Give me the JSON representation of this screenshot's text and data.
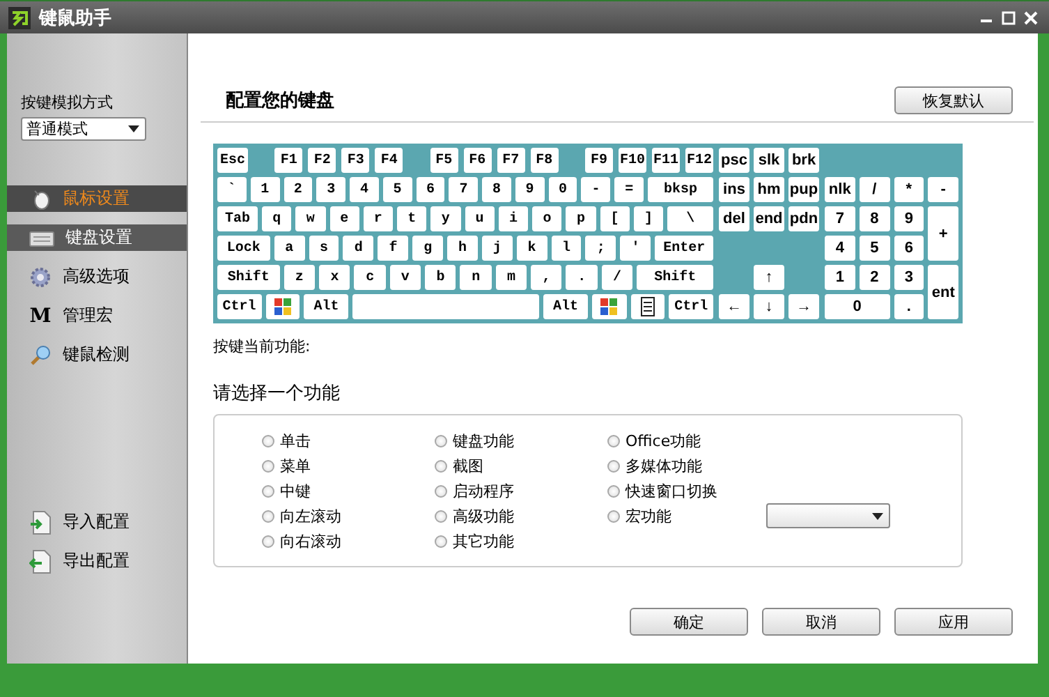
{
  "window": {
    "title": "键鼠助手"
  },
  "sidebar": {
    "mode_label": "按键模拟方式",
    "mode_value": "普通模式",
    "items": [
      {
        "kind": "mouse",
        "label": "鼠标设置",
        "selected": false,
        "hovered": true
      },
      {
        "kind": "keyboard",
        "label": "键盘设置",
        "selected": true,
        "hovered": false
      },
      {
        "kind": "gear",
        "label": "高级选项",
        "selected": false,
        "hovered": false
      },
      {
        "kind": "letter",
        "glyph": "M",
        "label": "管理宏",
        "selected": false,
        "hovered": false
      },
      {
        "kind": "magnifier",
        "label": "键鼠检测",
        "selected": false,
        "hovered": false
      }
    ],
    "bottom_items": [
      {
        "kind": "import",
        "label": "导入配置"
      },
      {
        "kind": "export",
        "label": "导出配置"
      }
    ]
  },
  "header": {
    "title": "配置您的键盘",
    "restore_button": "恢复默认"
  },
  "keyboard": {
    "main_rows": [
      [
        [
          {
            "kind": "key",
            "label": "Esc"
          }
        ],
        [
          {
            "kind": "key",
            "label": "F1"
          },
          {
            "kind": "key",
            "label": "F2"
          },
          {
            "kind": "key",
            "label": "F3"
          },
          {
            "kind": "key",
            "label": "F4"
          }
        ],
        [
          {
            "kind": "key",
            "label": "F5"
          },
          {
            "kind": "key",
            "label": "F6"
          },
          {
            "kind": "key",
            "label": "F7"
          },
          {
            "kind": "key",
            "label": "F8"
          }
        ],
        [
          {
            "kind": "key",
            "label": "F9"
          },
          {
            "kind": "key",
            "label": "F10"
          },
          {
            "kind": "key",
            "label": "F11"
          },
          {
            "kind": "key",
            "label": "F12"
          }
        ]
      ],
      [
        [
          {
            "kind": "key",
            "label": "`"
          },
          {
            "kind": "key",
            "label": "1"
          },
          {
            "kind": "key",
            "label": "2"
          },
          {
            "kind": "key",
            "label": "3"
          },
          {
            "kind": "key",
            "label": "4"
          },
          {
            "kind": "key",
            "label": "5"
          },
          {
            "kind": "key",
            "label": "6"
          },
          {
            "kind": "key",
            "label": "7"
          },
          {
            "kind": "key",
            "label": "8"
          },
          {
            "kind": "key",
            "label": "9"
          },
          {
            "kind": "key",
            "label": "0"
          },
          {
            "kind": "key",
            "label": "-"
          },
          {
            "kind": "key",
            "label": "="
          },
          {
            "kind": "key",
            "label": "bksp"
          }
        ]
      ],
      [
        [
          {
            "kind": "key",
            "label": "Tab"
          },
          {
            "kind": "key",
            "label": "q"
          },
          {
            "kind": "key",
            "label": "w"
          },
          {
            "kind": "key",
            "label": "e"
          },
          {
            "kind": "key",
            "label": "r"
          },
          {
            "kind": "key",
            "label": "t"
          },
          {
            "kind": "key",
            "label": "y"
          },
          {
            "kind": "key",
            "label": "u"
          },
          {
            "kind": "key",
            "label": "i"
          },
          {
            "kind": "key",
            "label": "o"
          },
          {
            "kind": "key",
            "label": "p"
          },
          {
            "kind": "key",
            "label": "["
          },
          {
            "kind": "key",
            "label": "]"
          },
          {
            "kind": "key",
            "label": "\\"
          }
        ]
      ],
      [
        [
          {
            "kind": "key",
            "label": "Lock"
          },
          {
            "kind": "key",
            "label": "a"
          },
          {
            "kind": "key",
            "label": "s"
          },
          {
            "kind": "key",
            "label": "d"
          },
          {
            "kind": "key",
            "label": "f"
          },
          {
            "kind": "key",
            "label": "g"
          },
          {
            "kind": "key",
            "label": "h"
          },
          {
            "kind": "key",
            "label": "j"
          },
          {
            "kind": "key",
            "label": "k"
          },
          {
            "kind": "key",
            "label": "l"
          },
          {
            "kind": "key",
            "label": ";"
          },
          {
            "kind": "key",
            "label": "'"
          },
          {
            "kind": "key",
            "label": "Enter"
          }
        ]
      ],
      [
        [
          {
            "kind": "key",
            "label": "Shift"
          },
          {
            "kind": "key",
            "label": "z"
          },
          {
            "kind": "key",
            "label": "x"
          },
          {
            "kind": "key",
            "label": "c"
          },
          {
            "kind": "key",
            "label": "v"
          },
          {
            "kind": "key",
            "label": "b"
          },
          {
            "kind": "key",
            "label": "n"
          },
          {
            "kind": "key",
            "label": "m"
          },
          {
            "kind": "key",
            "label": ","
          },
          {
            "kind": "key",
            "label": "."
          },
          {
            "kind": "key",
            "label": "/"
          },
          {
            "kind": "key",
            "label": "Shift"
          }
        ]
      ],
      [
        [
          {
            "kind": "key",
            "label": "Ctrl"
          },
          {
            "kind": "windows"
          },
          {
            "kind": "key",
            "label": "Alt"
          },
          {
            "kind": "space"
          },
          {
            "kind": "key",
            "label": "Alt"
          },
          {
            "kind": "windows"
          },
          {
            "kind": "menu"
          },
          {
            "kind": "key",
            "label": "Ctrl"
          }
        ]
      ]
    ],
    "nav_keys": [
      {
        "kind": "key",
        "label": "psc"
      },
      {
        "kind": "key",
        "label": "slk"
      },
      {
        "kind": "key",
        "label": "brk"
      },
      {
        "kind": "key",
        "label": "ins"
      },
      {
        "kind": "key",
        "label": "hm"
      },
      {
        "kind": "key",
        "label": "pup"
      },
      {
        "kind": "key",
        "label": "del"
      },
      {
        "kind": "key",
        "label": "end"
      },
      {
        "kind": "key",
        "label": "pdn"
      },
      {
        "kind": "key",
        "label": "↑"
      },
      {
        "kind": "key",
        "label": "←"
      },
      {
        "kind": "key",
        "label": "↓"
      },
      {
        "kind": "key",
        "label": "→"
      }
    ],
    "numpad_keys": [
      {
        "kind": "key",
        "label": "nlk"
      },
      {
        "kind": "key",
        "label": "/"
      },
      {
        "kind": "key",
        "label": "*"
      },
      {
        "kind": "key",
        "label": "-"
      },
      {
        "kind": "key",
        "label": "7"
      },
      {
        "kind": "key",
        "label": "8"
      },
      {
        "kind": "key",
        "label": "9"
      },
      {
        "kind": "key",
        "label": "+"
      },
      {
        "kind": "key",
        "label": "4"
      },
      {
        "kind": "key",
        "label": "5"
      },
      {
        "kind": "key",
        "label": "6"
      },
      {
        "kind": "key",
        "label": "1"
      },
      {
        "kind": "key",
        "label": "2"
      },
      {
        "kind": "key",
        "label": "3"
      },
      {
        "kind": "key",
        "label": "ent"
      },
      {
        "kind": "key",
        "label": "0"
      },
      {
        "kind": "key",
        "label": "."
      }
    ]
  },
  "current_function_label": "按键当前功能:",
  "function_heading": "请选择一个功能",
  "function_columns": [
    [
      {
        "label": "单击",
        "checked": false
      },
      {
        "label": "菜单",
        "checked": false
      },
      {
        "label": "中键",
        "checked": false
      },
      {
        "label": "向左滚动",
        "checked": false
      },
      {
        "label": "向右滚动",
        "checked": false
      }
    ],
    [
      {
        "label": "键盘功能",
        "checked": false
      },
      {
        "label": "截图",
        "checked": false
      },
      {
        "label": "启动程序",
        "checked": false
      },
      {
        "label": "高级功能",
        "checked": false
      },
      {
        "label": "其它功能",
        "checked": false
      }
    ],
    [
      {
        "label": "Office功能",
        "checked": false
      },
      {
        "label": "多媒体功能",
        "checked": false
      },
      {
        "label": "快速窗口切换",
        "checked": false
      },
      {
        "label": "宏功能",
        "checked": false
      }
    ]
  ],
  "buttons": [
    "确定",
    "取消",
    "应用"
  ]
}
